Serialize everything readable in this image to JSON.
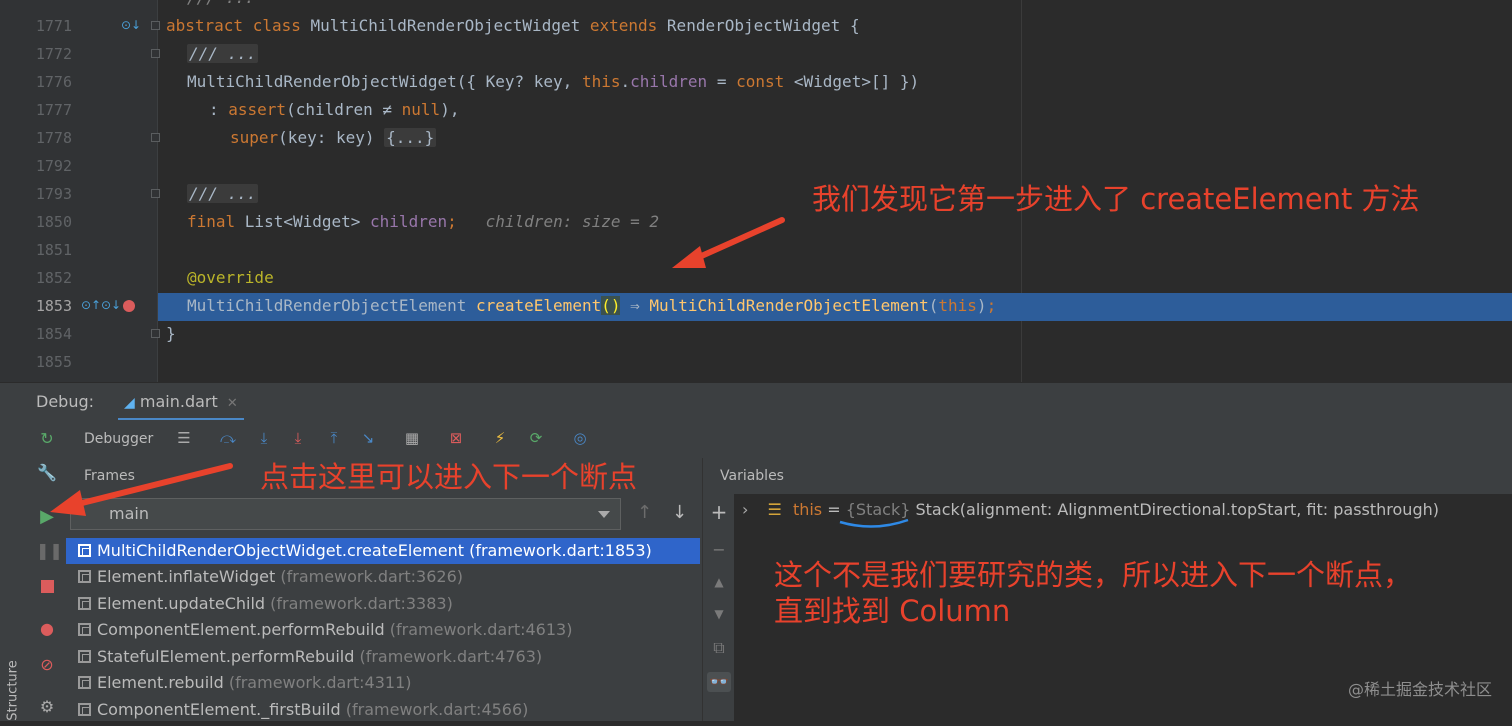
{
  "editor": {
    "lines": [
      {
        "num": "1771",
        "text": "abstract class MultiChildRenderObjectWidget extends RenderObjectWidget {"
      },
      {
        "num": "1772",
        "text": "/// ..."
      },
      {
        "num": "1776",
        "text": "MultiChildRenderObjectWidget({ Key? key, this.children = const <Widget>[] })"
      },
      {
        "num": "1777",
        "text": ": assert(children ≠ null),"
      },
      {
        "num": "1778",
        "text": "super(key: key) {...}"
      },
      {
        "num": "1792",
        "text": ""
      },
      {
        "num": "1793",
        "text": "/// ..."
      },
      {
        "num": "1850",
        "text": "final List<Widget> children;"
      },
      {
        "num": "1851",
        "text": ""
      },
      {
        "num": "1852",
        "text": "@override"
      },
      {
        "num": "1853",
        "text": "MultiChildRenderObjectElement createElement() ⇒ MultiChildRenderObjectElement(this);"
      },
      {
        "num": "1854",
        "text": "}"
      },
      {
        "num": "1855",
        "text": ""
      }
    ],
    "top_partial": "/// ...",
    "inline_hint": "children: size = 2",
    "annotation_top": "我们发现它第一步进入了 createElement 方法"
  },
  "debug": {
    "label": "Debug:",
    "tab": "main.dart",
    "debugger_label": "Debugger",
    "frames_label": "Frames",
    "variables_label": "Variables",
    "thread": "main",
    "structure_label": "Structure",
    "annotation_frames": "点击这里可以进入下一个断点",
    "annotation_vars_line1": "这个不是我们要研究的类，所以进入下一个断点，",
    "annotation_vars_line2": "直到找到 Column",
    "frames": [
      {
        "method": "MultiChildRenderObjectWidget.createElement",
        "loc": "(framework.dart:1853)",
        "selected": true
      },
      {
        "method": "Element.inflateWidget",
        "loc": "(framework.dart:3626)",
        "selected": false
      },
      {
        "method": "Element.updateChild",
        "loc": "(framework.dart:3383)",
        "selected": false
      },
      {
        "method": "ComponentElement.performRebuild",
        "loc": "(framework.dart:4613)",
        "selected": false
      },
      {
        "method": "StatefulElement.performRebuild",
        "loc": "(framework.dart:4763)",
        "selected": false
      },
      {
        "method": "Element.rebuild",
        "loc": "(framework.dart:4311)",
        "selected": false
      },
      {
        "method": "ComponentElement._firstBuild",
        "loc": "(framework.dart:4566)",
        "selected": false
      }
    ],
    "variable": {
      "name": "this",
      "eq": "=",
      "type": "{Stack}",
      "value": "Stack(alignment: AlignmentDirectional.topStart, fit: passthrough)"
    }
  },
  "watermark": "@稀土掘金技术社区",
  "colors": {
    "accent": "#2f65ca",
    "exec_line": "#2d5d9a",
    "annotation": "#e8422c",
    "breakpoint": "#db5c5c"
  }
}
